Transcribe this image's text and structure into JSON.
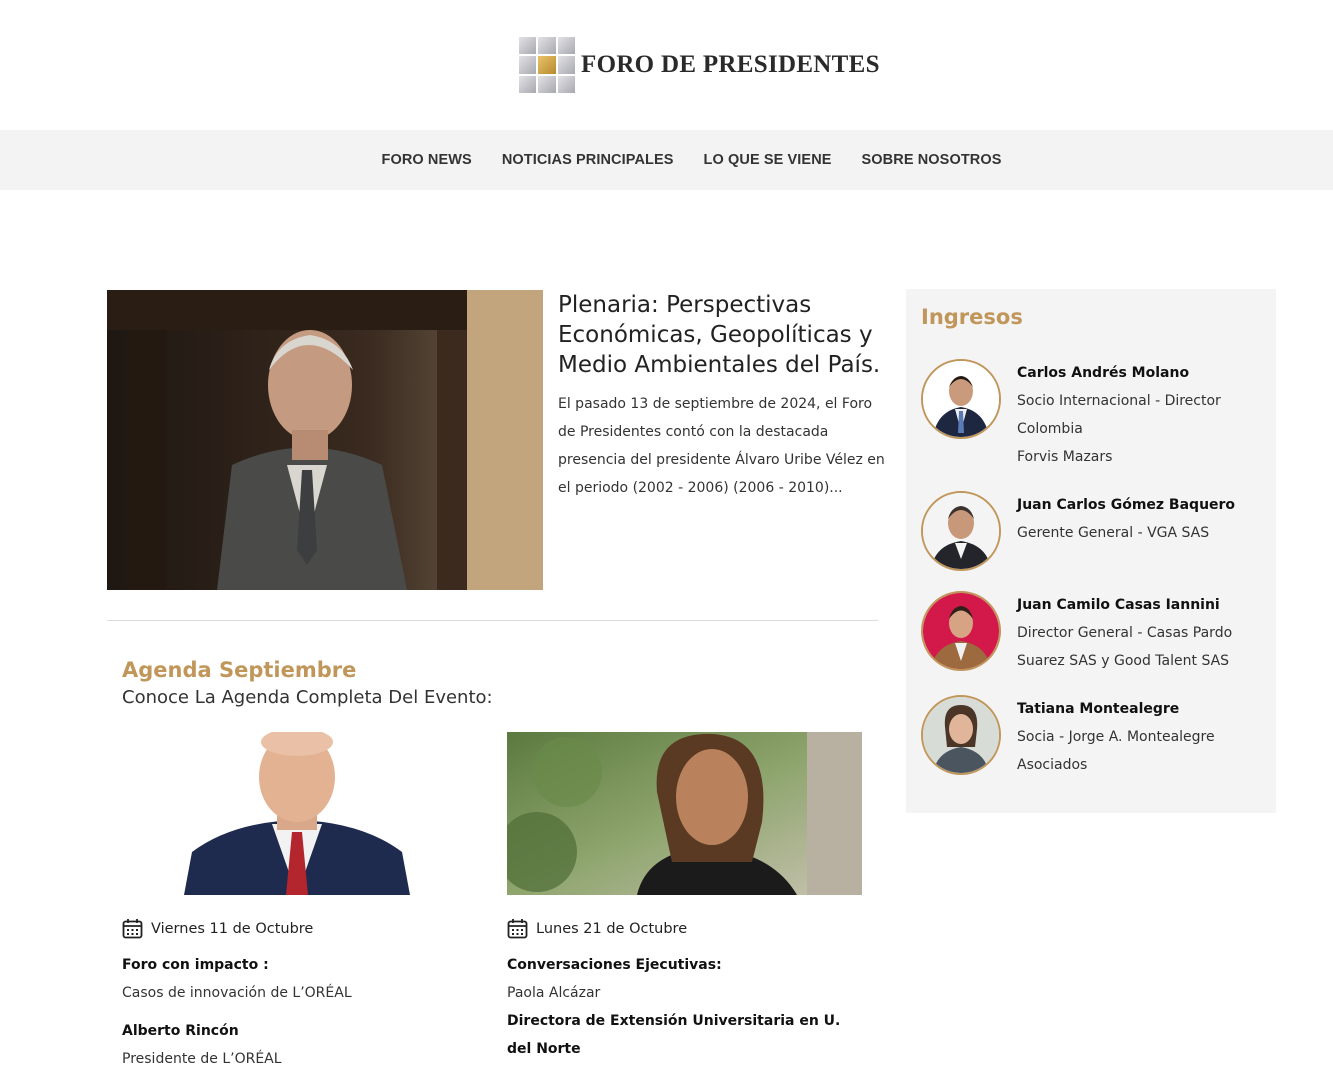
{
  "brand": {
    "name": "FORO DE PRESIDENTES"
  },
  "nav": {
    "items": [
      "FORO NEWS",
      "NOTICIAS PRINCIPALES",
      "LO QUE SE VIENE",
      "SOBRE NOSOTROS"
    ]
  },
  "featured": {
    "title": "Plenaria: Perspectivas Económicas, Geopolíticas y Medio Ambientales del País.",
    "excerpt": "El pasado 13 de septiembre de 2024, el Foro de Presidentes contó con la destacada presencia del presidente Álvaro Uribe Vélez en el periodo (2002 - 2006) (2006 - 2010)..."
  },
  "agenda": {
    "title": "Agenda Septiembre",
    "subtitle": "Conoce La Agenda Completa Del Evento:",
    "events": [
      {
        "date": "Viernes 11 de Octubre",
        "heading": "Foro con impacto :",
        "topic": "Casos de innovación de L’ORÉAL",
        "speaker": "Alberto Rincón",
        "speaker_role": "Presidente de L’ORÉAL"
      },
      {
        "date": "Lunes 21 de Octubre",
        "heading": "Conversaciones Ejecutivas:",
        "speaker": "Paola Alcázar",
        "speaker_role": "Directora de Extensión Universitaria en U. del Norte"
      }
    ]
  },
  "sidebar": {
    "title": "Ingresos",
    "items": [
      {
        "name": "Carlos Andrés Molano",
        "role": "Socio Internacional - Director Colombia",
        "company": "Forvis Mazars"
      },
      {
        "name": "Juan Carlos Gómez Baquero",
        "role": "Gerente General - VGA SAS"
      },
      {
        "name": "Juan Camilo Casas Iannini",
        "role": "Director General - Casas Pardo Suarez SAS y Good Talent SAS"
      },
      {
        "name": "Tatiana Montealegre",
        "role": "Socia - Jorge A. Montealegre Asociados"
      }
    ]
  },
  "colors": {
    "accent": "#c0965a",
    "nav_bg": "#f3f3f3",
    "sidebar_bg": "#f4f4f4"
  }
}
